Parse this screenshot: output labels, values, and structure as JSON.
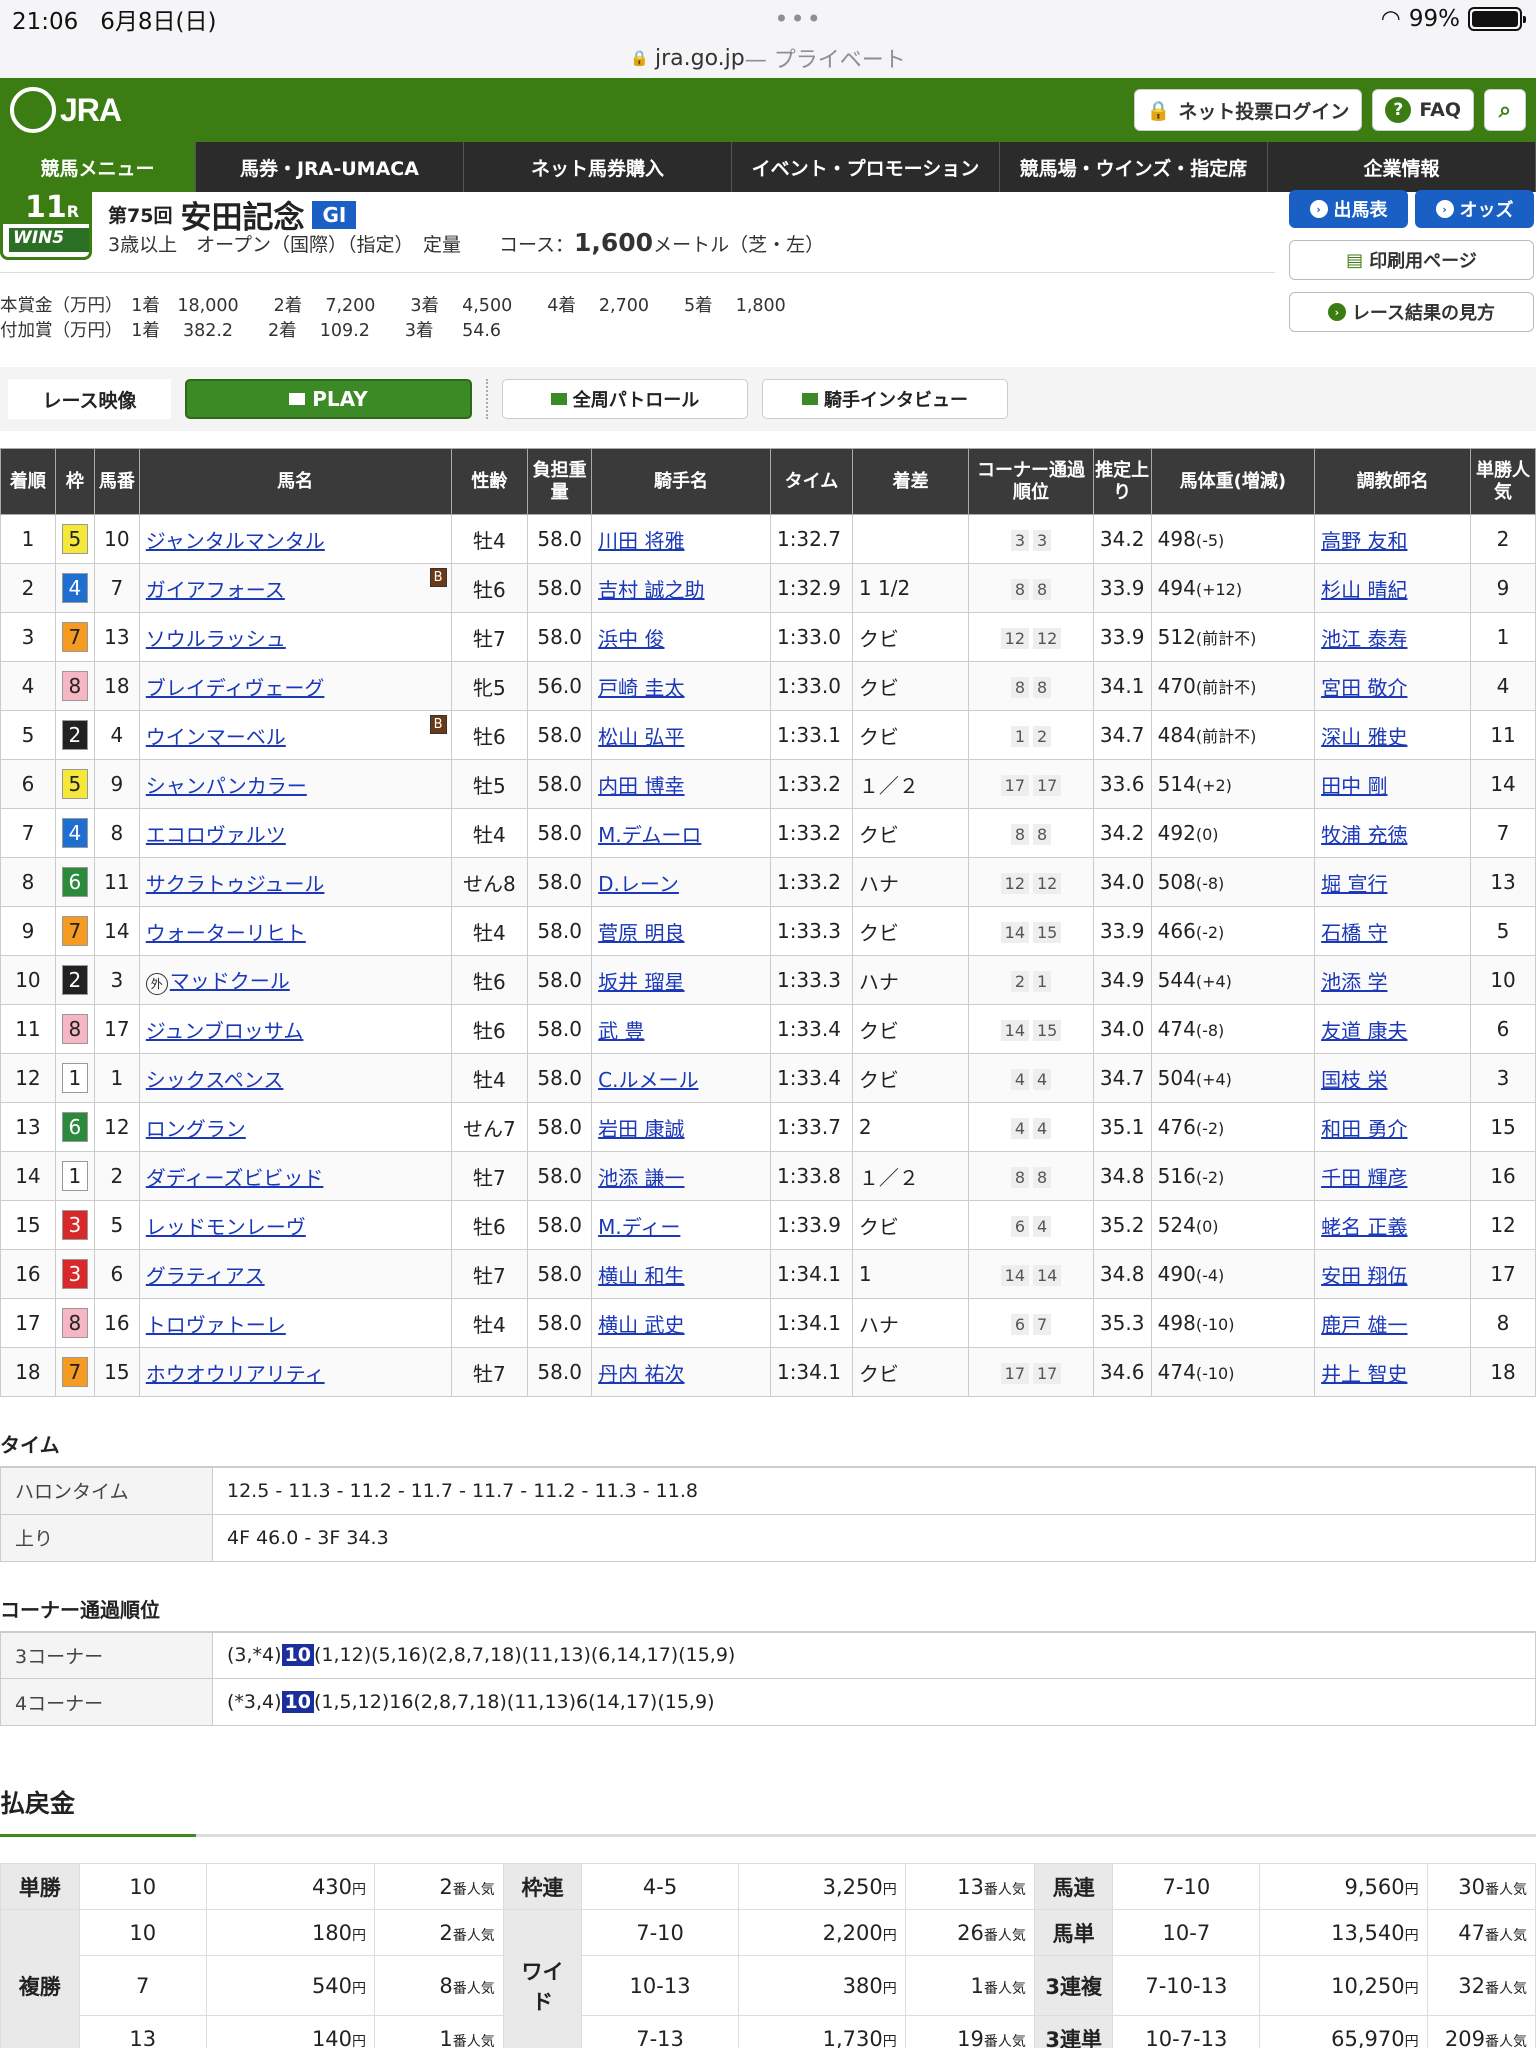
{
  "statusbar": {
    "time": "21:06",
    "date": "6月8日(日)",
    "battery": "99%"
  },
  "url": {
    "domain": "jra.go.jp",
    "private": " — プライベート"
  },
  "header": {
    "logo": "JRA",
    "login": "ネット投票ログイン",
    "faq": "FAQ"
  },
  "nav": [
    "競馬メニュー",
    "馬券・JRA-UMACA",
    "ネット馬券購入",
    "イベント・プロモーション",
    "競馬場・ウインズ・指定席",
    "企業情報"
  ],
  "race": {
    "num": "11",
    "r": "R",
    "win5": "WIN5",
    "kai": "第75回",
    "name": "安田記念",
    "grade": "GI",
    "cond": "3歳以上　オープン（国際）（指定）　定量　　コース：",
    "dist": "1,600",
    "dist_unit": "メートル（芝・左）",
    "prize1": "本賞金（万円）　1着　18,000　　2着　 7,200　　3着　 4,500　　4着　 2,700　　5着　 1,800",
    "prize2": "付加賞（万円）　1着　 382.2　　2着　 109.2　　3着　  54.6",
    "btn_entries": "出馬表",
    "btn_odds": "オッズ",
    "btn_print": "印刷用ページ",
    "btn_guide": "レース結果の見方"
  },
  "video": {
    "label": "レース映像",
    "play": "PLAY",
    "patrol": "全周パトロール",
    "interview": "騎手インタビュー"
  },
  "results": {
    "headers": [
      "着順",
      "枠",
      "馬番",
      "馬名",
      "性齢",
      "負担重量",
      "騎手名",
      "タイム",
      "着差",
      "コーナー通過順位",
      "推定上り",
      "馬体重(増減)",
      "調教師名",
      "単勝人気"
    ],
    "rows": [
      [
        "1",
        "5",
        "10",
        "ジャンタルマンタル",
        "",
        "牡4",
        "58.0",
        "川田 将雅",
        "1:32.7",
        "",
        "3",
        "3",
        "34.2",
        "498",
        "(-5)",
        "高野 友和",
        "2"
      ],
      [
        "2",
        "4",
        "7",
        "ガイアフォース",
        "B",
        "牡6",
        "58.0",
        "吉村 誠之助",
        "1:32.9",
        "1 1/2",
        "8",
        "8",
        "33.9",
        "494",
        "(+12)",
        "杉山 晴紀",
        "9"
      ],
      [
        "3",
        "7",
        "13",
        "ソウルラッシュ",
        "",
        "牡7",
        "58.0",
        "浜中 俊",
        "1:33.0",
        "クビ",
        "12",
        "12",
        "33.9",
        "512",
        "(前計不)",
        "池江 泰寿",
        "1"
      ],
      [
        "4",
        "8",
        "18",
        "ブレイディヴェーグ",
        "",
        "牝5",
        "56.0",
        "戸崎 圭太",
        "1:33.0",
        "クビ",
        "8",
        "8",
        "34.1",
        "470",
        "(前計不)",
        "宮田 敬介",
        "4"
      ],
      [
        "5",
        "2",
        "4",
        "ウインマーベル",
        "B",
        "牡6",
        "58.0",
        "松山 弘平",
        "1:33.1",
        "クビ",
        "1",
        "2",
        "34.7",
        "484",
        "(前計不)",
        "深山 雅史",
        "11"
      ],
      [
        "6",
        "5",
        "9",
        "シャンパンカラー",
        "",
        "牡5",
        "58.0",
        "内田 博幸",
        "1:33.2",
        "１／２",
        "17",
        "17",
        "33.6",
        "514",
        "(+2)",
        "田中 剛",
        "14"
      ],
      [
        "7",
        "4",
        "8",
        "エコロヴァルツ",
        "",
        "牡4",
        "58.0",
        "M.デムーロ",
        "1:33.2",
        "クビ",
        "8",
        "8",
        "34.2",
        "492",
        "(0)",
        "牧浦 充徳",
        "7"
      ],
      [
        "8",
        "6",
        "11",
        "サクラトゥジュール",
        "",
        "せん8",
        "58.0",
        "D.レーン",
        "1:33.2",
        "ハナ",
        "12",
        "12",
        "34.0",
        "508",
        "(-8)",
        "堀 宣行",
        "13"
      ],
      [
        "9",
        "7",
        "14",
        "ウォーターリヒト",
        "",
        "牡4",
        "58.0",
        "菅原 明良",
        "1:33.3",
        "クビ",
        "14",
        "15",
        "33.9",
        "466",
        "(-2)",
        "石橋 守",
        "5"
      ],
      [
        "10",
        "2",
        "3",
        "マッドクール",
        "外",
        "牡6",
        "58.0",
        "坂井 瑠星",
        "1:33.3",
        "ハナ",
        "2",
        "1",
        "34.9",
        "544",
        "(+4)",
        "池添 学",
        "10"
      ],
      [
        "11",
        "8",
        "17",
        "ジュンブロッサム",
        "",
        "牡6",
        "58.0",
        "武 豊",
        "1:33.4",
        "クビ",
        "14",
        "15",
        "34.0",
        "474",
        "(-8)",
        "友道 康夫",
        "6"
      ],
      [
        "12",
        "1",
        "1",
        "シックスペンス",
        "",
        "牡4",
        "58.0",
        "C.ルメール",
        "1:33.4",
        "クビ",
        "4",
        "4",
        "34.7",
        "504",
        "(+4)",
        "国枝 栄",
        "3"
      ],
      [
        "13",
        "6",
        "12",
        "ロングラン",
        "",
        "せん7",
        "58.0",
        "岩田 康誠",
        "1:33.7",
        "2",
        "4",
        "4",
        "35.1",
        "476",
        "(-2)",
        "和田 勇介",
        "15"
      ],
      [
        "14",
        "1",
        "2",
        "ダディーズビビッド",
        "",
        "牡7",
        "58.0",
        "池添 謙一",
        "1:33.8",
        "１／２",
        "8",
        "8",
        "34.8",
        "516",
        "(-2)",
        "千田 輝彦",
        "16"
      ],
      [
        "15",
        "3",
        "5",
        "レッドモンレーヴ",
        "",
        "牡6",
        "58.0",
        "M.ディー",
        "1:33.9",
        "クビ",
        "6",
        "4",
        "35.2",
        "524",
        "(0)",
        "蛯名 正義",
        "12"
      ],
      [
        "16",
        "3",
        "6",
        "グラティアス",
        "",
        "牡7",
        "58.0",
        "横山 和生",
        "1:34.1",
        "1",
        "14",
        "14",
        "34.8",
        "490",
        "(-4)",
        "安田 翔伍",
        "17"
      ],
      [
        "17",
        "8",
        "16",
        "トロヴァトーレ",
        "",
        "牡4",
        "58.0",
        "横山 武史",
        "1:34.1",
        "ハナ",
        "6",
        "7",
        "35.3",
        "498",
        "(-10)",
        "鹿戸 雄一",
        "8"
      ],
      [
        "18",
        "7",
        "15",
        "ホウオウリアリティ",
        "",
        "牡7",
        "58.0",
        "丹内 祐次",
        "1:34.1",
        "クビ",
        "17",
        "17",
        "34.6",
        "474",
        "(-10)",
        "井上 智史",
        "18"
      ]
    ]
  },
  "time": {
    "title": "タイム",
    "haron_label": "ハロンタイム",
    "haron": "12.5 - 11.3 - 11.2 - 11.7 - 11.7 - 11.2 - 11.3 - 11.8",
    "agari_label": "上り",
    "agari": "4F 46.0 - 3F 34.3"
  },
  "corner": {
    "title": "コーナー通過順位",
    "c3_label": "3コーナー",
    "c3_pre": "(3,*4)",
    "c3_hl": "10",
    "c3_post": "(1,12)(5,16)(2,8,7,18)(11,13)(6,14,17)(15,9)",
    "c4_label": "4コーナー",
    "c4_pre": "(*3,4)",
    "c4_hl": "10",
    "c4_post": "(1,5,12)16(2,8,7,18)(11,13)6(14,17)(15,9)"
  },
  "payout": {
    "title": "払戻金",
    "yen": "円",
    "pop": "番人気",
    "tansho": {
      "label": "単勝",
      "num": "10",
      "amt": "430",
      "pop": "2"
    },
    "fukusho": {
      "label": "複勝",
      "rows": [
        [
          "10",
          "180",
          "2"
        ],
        [
          "7",
          "540",
          "8"
        ],
        [
          "13",
          "140",
          "1"
        ]
      ]
    },
    "wakuren": {
      "label": "枠連",
      "num": "4-5",
      "amt": "3,250",
      "pop": "13"
    },
    "wide": {
      "label": "ワイド",
      "rows": [
        [
          "7-10",
          "2,200",
          "26"
        ],
        [
          "10-13",
          "380",
          "1"
        ],
        [
          "7-13",
          "1,730",
          "19"
        ]
      ]
    },
    "umaren": {
      "label": "馬連",
      "num": "7-10",
      "amt": "9,560",
      "pop": "30"
    },
    "umatan": {
      "label": "馬単",
      "num": "10-7",
      "amt": "13,540",
      "pop": "47"
    },
    "sanrenpuku": {
      "label": "3連複",
      "num": "7-10-13",
      "amt": "10,250",
      "pop": "32"
    },
    "sanrentan": {
      "label": "3連単",
      "num": "10-7-13",
      "amt": "65,970",
      "pop": "209"
    }
  }
}
